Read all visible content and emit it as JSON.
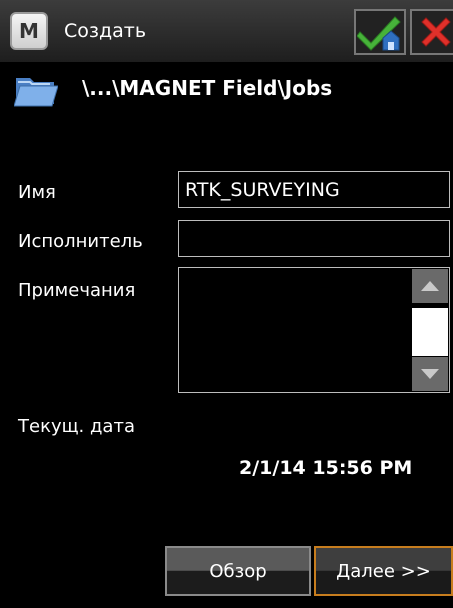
{
  "titlebar": {
    "logo_letter": "M",
    "title": "Создать",
    "ok_icon": "check-home-icon",
    "cancel_icon": "close-icon"
  },
  "path": {
    "icon": "folder-icon",
    "text": "\\...\\MAGNET Field\\Jobs"
  },
  "form": {
    "name_label": "Имя",
    "name_value": "RTK_SURVEYING",
    "performer_label": "Исполнитель",
    "performer_value": "",
    "notes_label": "Примечания",
    "notes_value": "",
    "date_label": "Текущ. дата",
    "date_value": "2/1/14 15:56 PM"
  },
  "buttons": {
    "browse": "Обзор",
    "next": "Далее >>"
  },
  "colors": {
    "accent_next_border": "#c77d1e",
    "check_green": "#47b33a",
    "close_red": "#e0302a"
  }
}
